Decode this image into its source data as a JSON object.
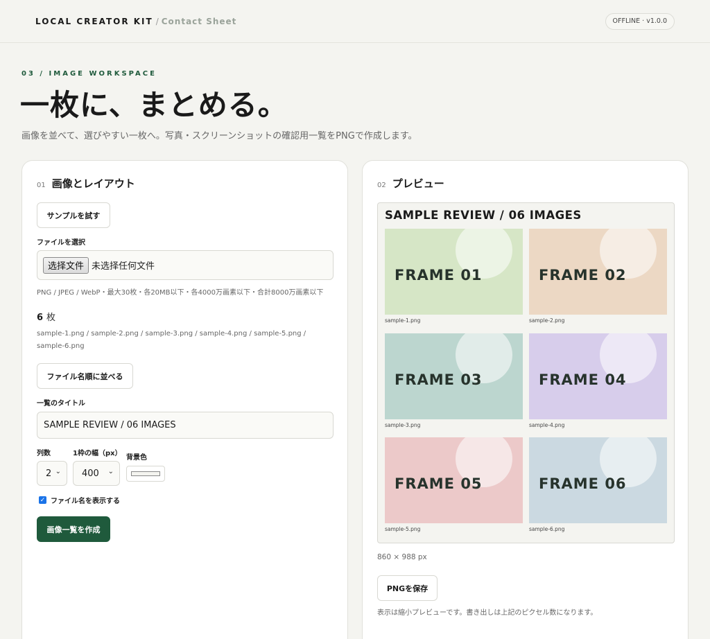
{
  "header": {
    "brand": "LOCAL CREATOR KIT",
    "separator": "/",
    "subtitle": "Contact Sheet",
    "status": "OFFLINE · v1.0.0"
  },
  "hero": {
    "eyebrow": "03 / IMAGE WORKSPACE",
    "title": "一枚に、まとめる。",
    "description": "画像を並べて、選びやすい一枚へ。写真・スクリーンショットの確認用一覧をPNGで作成します。"
  },
  "left_panel": {
    "number": "01",
    "title": "画像とレイアウト",
    "sample_button": "サンプルを試す",
    "file_label": "ファイルを選択",
    "file_button": "选择文件",
    "file_status": "未选择任何文件",
    "file_note": "PNG / JPEG / WebP・最大30枚・各20MB以下・各4000万画素以下・合計8000万画素以下",
    "count": "6",
    "count_unit": "枚",
    "file_list": "sample-1.png / sample-2.png / sample-3.png / sample-4.png / sample-5.png / sample-6.png",
    "sort_button": "ファイル名順に並べる",
    "title_label": "一覧のタイトル",
    "title_value": "SAMPLE REVIEW / 06 IMAGES",
    "columns_label": "列数",
    "columns_value": "2",
    "width_label": "1枠の幅（px）",
    "width_value": "400",
    "bg_label": "背景色",
    "bg_color": "#f4f4f0",
    "show_names_label": "ファイル名を表示する",
    "show_names_checked": true,
    "create_button": "画像一覧を作成"
  },
  "right_panel": {
    "number": "02",
    "title": "プレビュー",
    "preview_title": "SAMPLE REVIEW / 06 IMAGES",
    "tiles": [
      {
        "label": "FRAME 01",
        "caption": "sample-1.png",
        "color": "#d6e6c6"
      },
      {
        "label": "FRAME 02",
        "caption": "sample-2.png",
        "color": "#ecd8c4"
      },
      {
        "label": "FRAME 03",
        "caption": "sample-3.png",
        "color": "#bcd6cf"
      },
      {
        "label": "FRAME 04",
        "caption": "sample-4.png",
        "color": "#d7cdeb"
      },
      {
        "label": "FRAME 05",
        "caption": "sample-5.png",
        "color": "#ecc9c9"
      },
      {
        "label": "FRAME 06",
        "caption": "sample-6.png",
        "color": "#cbd9e1"
      }
    ],
    "dimensions": "860 × 988 px",
    "save_button": "PNGを保存",
    "save_note": "表示は縮小プレビューです。書き出しは上記のピクセル数になります。"
  }
}
